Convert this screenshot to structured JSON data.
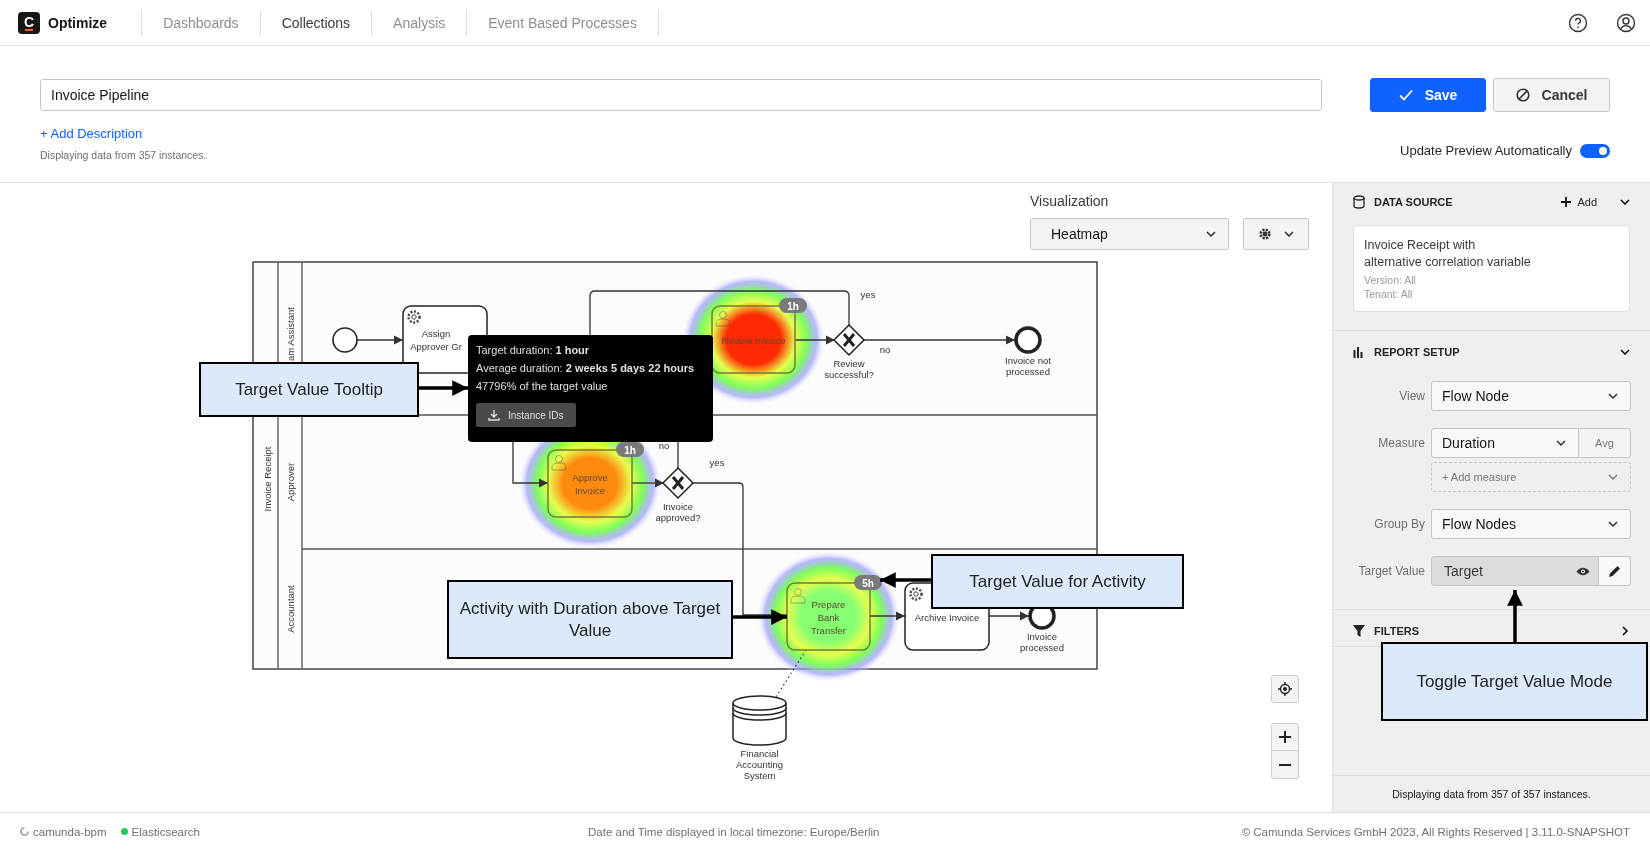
{
  "app": {
    "logo": "C",
    "name": "Optimize"
  },
  "nav": [
    {
      "label": "Dashboards",
      "selected": false
    },
    {
      "label": "Collections",
      "selected": true
    },
    {
      "label": "Analysis",
      "selected": false
    },
    {
      "label": "Event Based Processes",
      "selected": false
    }
  ],
  "report": {
    "name": "Invoice Pipeline",
    "add_description": "+ Add Description",
    "instances_note": "Displaying data from 357 instances.",
    "save": "Save",
    "cancel": "Cancel",
    "auto_preview": {
      "label": "Update Preview Automatically",
      "on": true
    }
  },
  "visualization": {
    "label": "Visualization",
    "value": "Heatmap"
  },
  "diagram": {
    "pool": "Invoice Receipt",
    "lanes": [
      "am Assistant",
      "Approver",
      "Accountant"
    ],
    "tasks": [
      {
        "kind": "service",
        "lines": [
          "Assign",
          "Approver Gr"
        ]
      },
      {
        "kind": "user",
        "lines": [
          "Review Invoice"
        ],
        "color": "#ff2a00",
        "badge": "1h"
      },
      {
        "kind": "user",
        "lines": [
          "Approve",
          "Invoice"
        ],
        "color": "#ff8a10",
        "badge": "1h"
      },
      {
        "kind": "user",
        "lines": [
          "Prepare",
          "Bank",
          "Transfer"
        ],
        "color": "#86ff72",
        "badge": "5h"
      },
      {
        "kind": "service",
        "lines": [
          "Archive Invoice"
        ]
      }
    ],
    "gateways": [
      {
        "lines": [
          "Review",
          "successful?"
        ]
      },
      {
        "lines": [
          "Invoice",
          "approved?"
        ]
      }
    ],
    "end_events": [
      {
        "lines": [
          "Invoice not",
          "processed"
        ]
      },
      {
        "lines": [
          "Invoice",
          "processed"
        ]
      }
    ],
    "flow_labels": [
      "yes",
      "no",
      "no",
      "yes"
    ],
    "data_store": {
      "lines": [
        "Financial",
        "Accounting",
        "System"
      ]
    },
    "tooltip": {
      "lines": [
        "Target duration: **1 hour**",
        "Average duration: **2 weeks 5 days 22 hours**",
        "47796% of the target value"
      ],
      "button": "Instance IDs"
    }
  },
  "annotations": [
    "Target Value Tooltip",
    "Activity with Duration above Target Value",
    "Target Value for Activity",
    "Toggle Target Value Mode"
  ],
  "panel": {
    "data_source": {
      "title": "DATA SOURCE",
      "add": "Add",
      "process": [
        "Invoice Receipt with",
        "alternative correlation variable"
      ],
      "version": "Version: All",
      "tenant": "Tenant: All"
    },
    "report_setup": {
      "title": "REPORT SETUP",
      "view": {
        "label": "View",
        "value": "Flow Node"
      },
      "measure": {
        "label": "Measure",
        "value": "Duration",
        "aggregation": "Avg",
        "add": "+ Add measure"
      },
      "group_by": {
        "label": "Group By",
        "value": "Flow Nodes"
      },
      "target_value": {
        "label": "Target Value",
        "value": "Target",
        "active": true
      }
    },
    "filters": {
      "title": "FILTERS",
      "expanded": false
    },
    "footer": "Displaying data from 357 of 357 instances."
  },
  "footer": {
    "engine": "camunda-bpm",
    "database": {
      "name": "Elasticsearch",
      "color": "#24c95f"
    },
    "timezone": "Date and Time displayed in local timezone: Europe/Berlin",
    "copyright": "© Camunda Services GmbH 2023, All Rights Reserved | 3.11.0-SNAPSHOT"
  }
}
